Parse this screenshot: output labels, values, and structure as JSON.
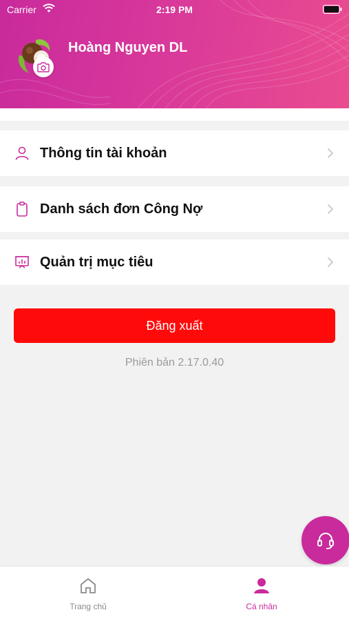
{
  "status_bar": {
    "carrier": "Carrier",
    "time": "2:19 PM"
  },
  "profile": {
    "name": "Hoàng Nguyen DL"
  },
  "menu": {
    "items": [
      {
        "label": "Thông tin tài khoản",
        "icon": "user-icon"
      },
      {
        "label": "Danh sách đơn Công Nợ",
        "icon": "clipboard-icon"
      },
      {
        "label": "Quản trị mục tiêu",
        "icon": "presentation-chart-icon"
      }
    ]
  },
  "logout": {
    "label": "Đăng xuất"
  },
  "version": {
    "text": "Phiên bản 2.17.0.40"
  },
  "tabbar": {
    "home_label": "Trang chủ",
    "profile_label": "Cá nhân"
  },
  "colors": {
    "brand": "#c92a9c",
    "logout": "#ff0a0a",
    "inactive": "#8a8a8a"
  }
}
